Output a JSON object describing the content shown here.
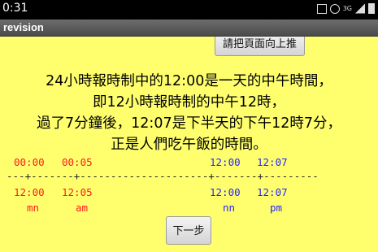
{
  "status_bar": {
    "time": "0:31",
    "network_label": "3G"
  },
  "app": {
    "title": "revision"
  },
  "buttons": {
    "scroll_up": "請把頁面向上推",
    "next": "下一步"
  },
  "paragraph": [
    "24小時報時制中的12:00是一天的中午時間，",
    "即12小時報時制的中午12時，",
    "過了7分鐘後，12:07是下半天的下午12時7分，",
    "正是人們吃午飯的時間。"
  ],
  "timeline": {
    "top_red": [
      "00:00",
      "00:05"
    ],
    "top_blue": [
      "12:00",
      "12:07"
    ],
    "axis_line": "---+-------+---------------------+-------+---------",
    "bottom_red": [
      "12:00",
      "12:05"
    ],
    "bottom_red_sub": [
      "mn",
      "am"
    ],
    "bottom_blue": [
      "12:00",
      "12:07"
    ],
    "bottom_blue_sub": [
      "nn",
      "pm"
    ]
  },
  "colors": {
    "background": "#ffff6e",
    "red": "#ff1a1a",
    "blue": "#2525ff"
  },
  "icons": [
    "notification-icon",
    "alarm-icon",
    "network-icon",
    "signal-icon",
    "battery-icon"
  ]
}
